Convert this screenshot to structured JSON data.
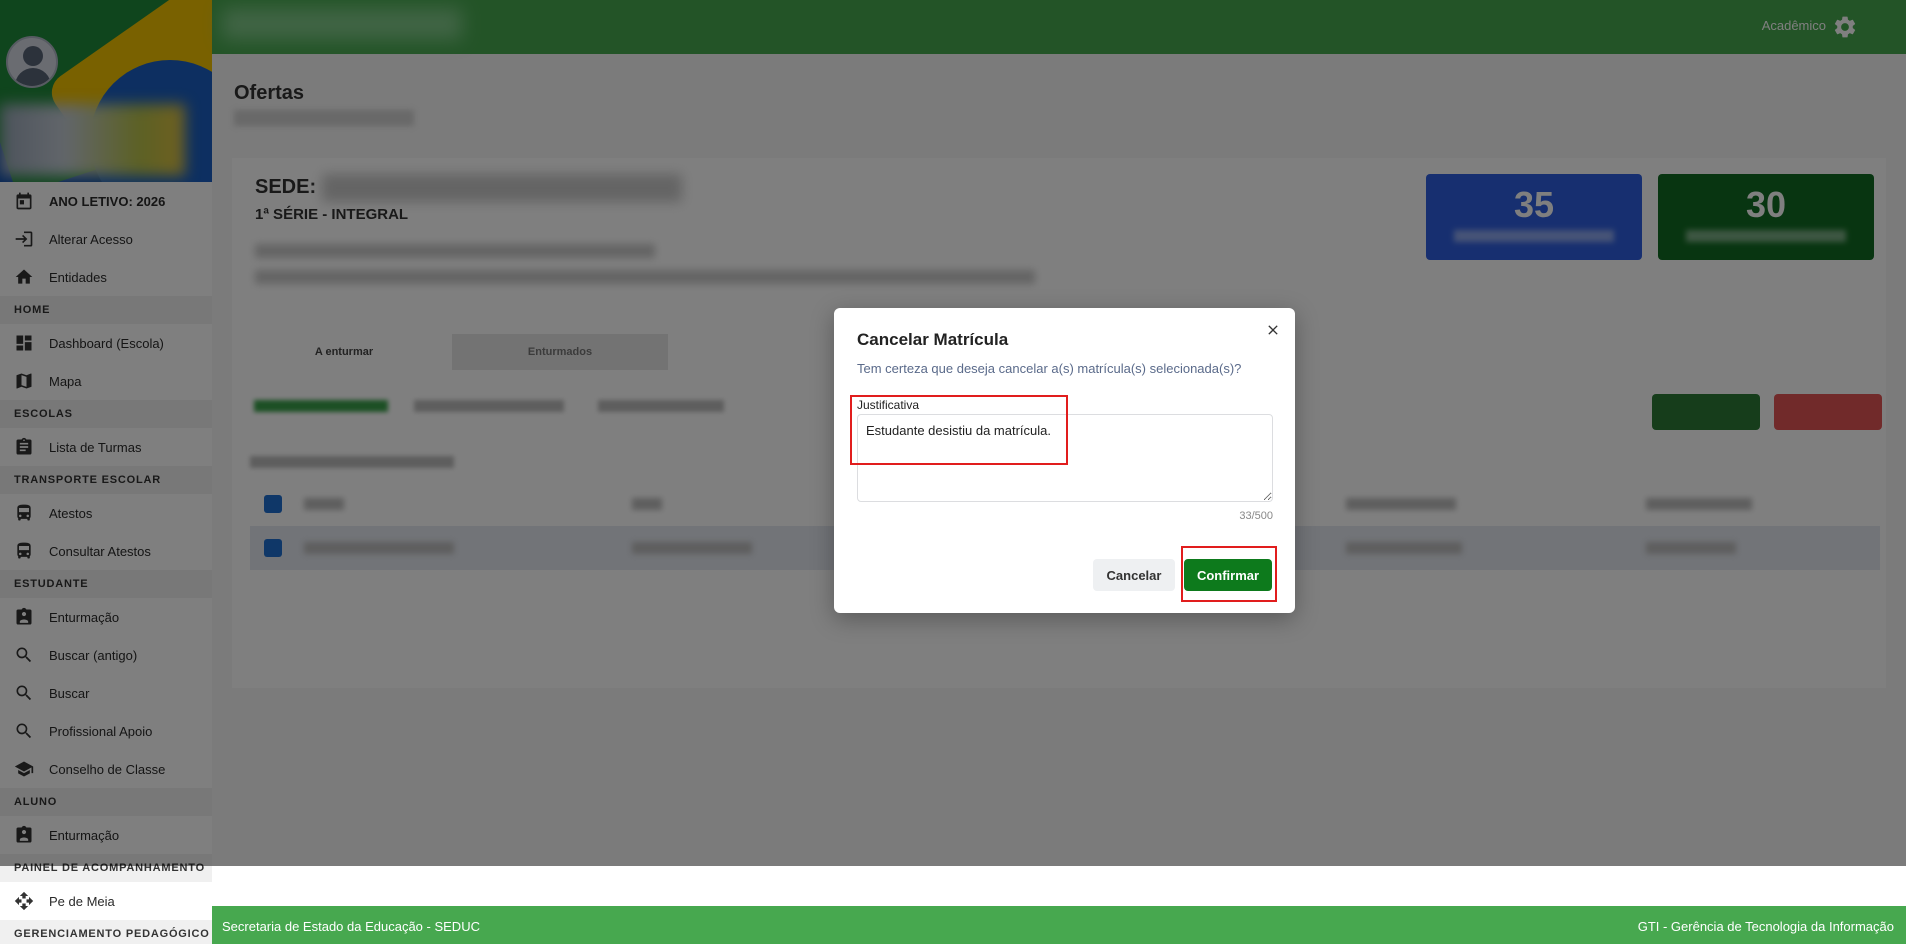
{
  "sidebar": {
    "items": [
      {
        "label": "ANO LETIVO: 2026",
        "icon": "calendar-icon",
        "bold": true
      },
      {
        "label": "Alterar Acesso",
        "icon": "login-icon"
      },
      {
        "label": "Entidades",
        "icon": "home-icon"
      }
    ],
    "sections": [
      {
        "title": "HOME",
        "items": [
          {
            "label": "Dashboard (Escola)",
            "icon": "dashboard-icon"
          },
          {
            "label": "Mapa",
            "icon": "map-icon"
          }
        ]
      },
      {
        "title": "ESCOLAS",
        "items": [
          {
            "label": "Lista de Turmas",
            "icon": "clipboard-icon"
          }
        ]
      },
      {
        "title": "TRANSPORTE ESCOLAR",
        "items": [
          {
            "label": "Atestos",
            "icon": "bus-icon"
          },
          {
            "label": "Consultar Atestos",
            "icon": "bus-icon"
          }
        ]
      },
      {
        "title": "ESTUDANTE",
        "items": [
          {
            "label": "Enturmação",
            "icon": "badge-icon"
          },
          {
            "label": "Buscar (antigo)",
            "icon": "search-icon"
          },
          {
            "label": "Buscar",
            "icon": "search-icon"
          },
          {
            "label": "Profissional Apoio",
            "icon": "search-icon"
          },
          {
            "label": "Conselho de Classe",
            "icon": "school-icon"
          }
        ]
      },
      {
        "title": "ALUNO",
        "items": [
          {
            "label": "Enturmação",
            "icon": "badge-icon"
          }
        ]
      },
      {
        "title": "PAINEL DE ACOMPANHAMENTO",
        "items": [
          {
            "label": "Pe de Meia",
            "icon": "move-icon"
          }
        ]
      },
      {
        "title": "GERENCIAMENTO PEDAGÓGICO",
        "items": []
      }
    ]
  },
  "topbar": {
    "role": "Acadêmico",
    "settings_icon": "gear-icon"
  },
  "main": {
    "title": "Ofertas",
    "sede_label": "SEDE:",
    "serie": "1ª SÉRIE - INTEGRAL",
    "stats": [
      {
        "value": "35",
        "color": "#2f5fe0"
      },
      {
        "value": "30",
        "color": "#116b22"
      }
    ],
    "tabs": [
      "A enturmar",
      "Enturmados"
    ]
  },
  "modal": {
    "title": "Cancelar Matrícula",
    "question": "Tem certeza que deseja cancelar a(s) matrícula(s) selecionada(s)?",
    "field_label": "Justificativa",
    "field_value": "Estudante desistiu da matrícula.",
    "counter": "33/500",
    "cancel_label": "Cancelar",
    "confirm_label": "Confirmar"
  },
  "footer": {
    "left": "Secretaria de Estado da Educação - SEDUC",
    "right": "GTI - Gerência de Tecnologia da Informação"
  },
  "colors": {
    "green": "#47a84f",
    "confirm": "#0d7a1c",
    "highlight": "#e11d1d"
  }
}
